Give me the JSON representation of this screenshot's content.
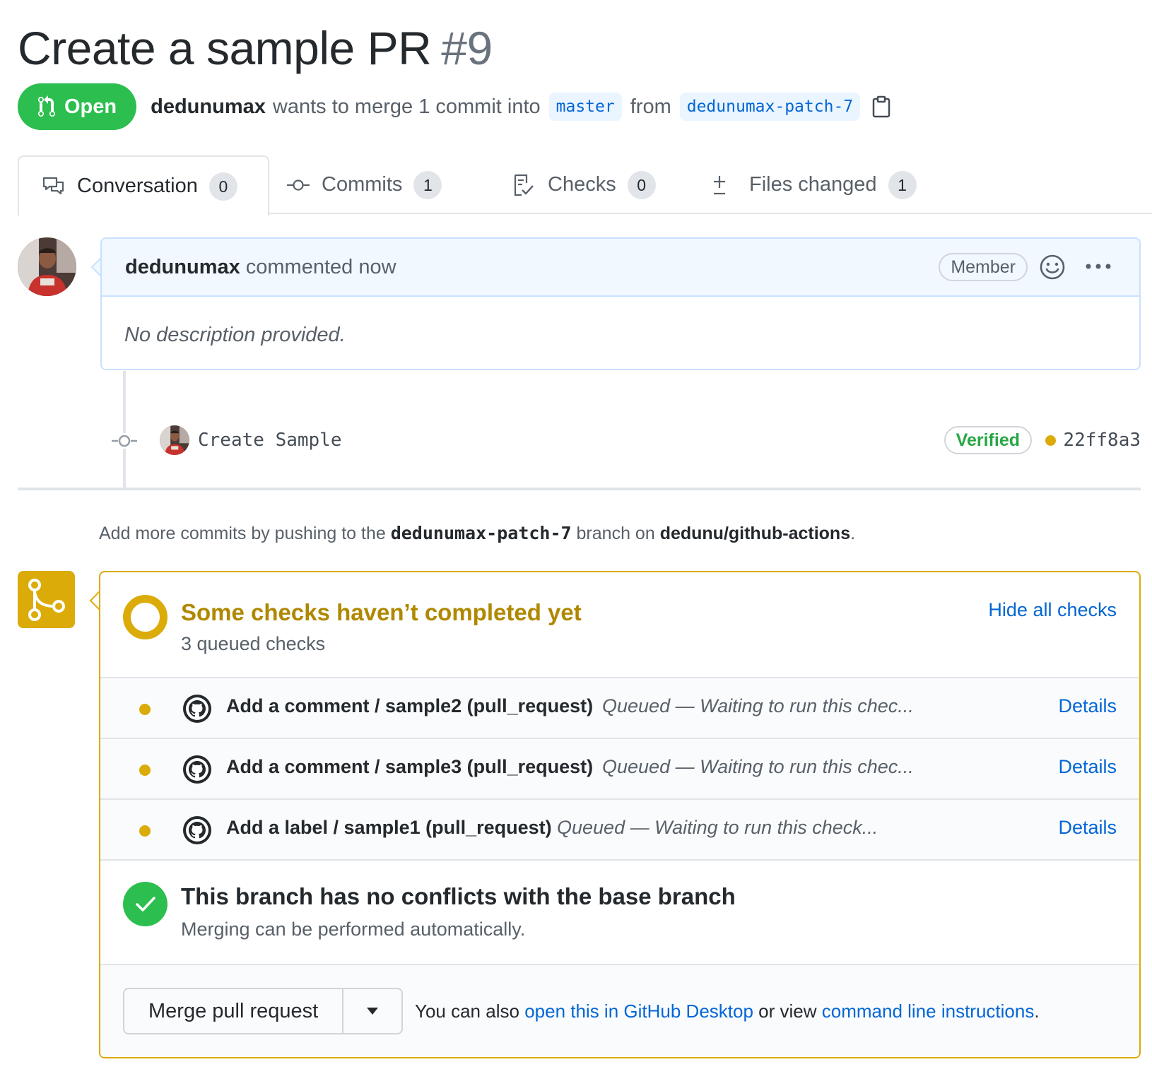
{
  "pr": {
    "title": "Create a sample PR",
    "number": "#9",
    "state": "Open",
    "author": "dedunumax",
    "merge_text": "wants to merge 1 commit into",
    "base_branch": "master",
    "from_text": "from",
    "head_branch": "dedunumax-patch-7"
  },
  "tabs": [
    {
      "label": "Conversation",
      "count": "0",
      "icon": "comment-discussion-icon"
    },
    {
      "label": "Commits",
      "count": "1",
      "icon": "commit-icon"
    },
    {
      "label": "Checks",
      "count": "0",
      "icon": "checklist-icon"
    },
    {
      "label": "Files changed",
      "count": "1",
      "icon": "diff-icon"
    }
  ],
  "comment": {
    "author": "dedunumax",
    "action": "commented now",
    "badge": "Member",
    "body": "No description provided."
  },
  "commit": {
    "message": "Create Sample",
    "verified": "Verified",
    "sha": "22ff8a3"
  },
  "push_hint": {
    "prefix": "Add more commits by pushing to the",
    "branch": "dedunumax-patch-7",
    "middle": "branch on",
    "repo": "dedunu/github-actions",
    "suffix": "."
  },
  "checks": {
    "title": "Some checks haven’t completed yet",
    "subtitle": "3 queued checks",
    "hide_label": "Hide all checks",
    "items": [
      {
        "name": "Add a comment / sample2 (pull_request)",
        "status": "Queued — Waiting to run this chec...",
        "details": "Details"
      },
      {
        "name": "Add a comment / sample3 (pull_request)",
        "status": "Queued — Waiting to run this chec...",
        "details": "Details"
      },
      {
        "name": "Add a label / sample1 (pull_request)",
        "status": "Queued — Waiting to run this check...",
        "details": "Details"
      }
    ]
  },
  "conflicts": {
    "title": "This branch has no conflicts with the base branch",
    "subtitle": "Merging can be performed automatically."
  },
  "merge": {
    "button": "Merge pull request",
    "text_prefix": "You can also",
    "desktop_link": "open this in GitHub Desktop",
    "text_middle": "or view",
    "cli_link": "command line instructions",
    "text_suffix": "."
  },
  "colors": {
    "open_green": "#2cbe4e",
    "pending_yellow": "#dbab09",
    "link_blue": "#0366d6"
  }
}
